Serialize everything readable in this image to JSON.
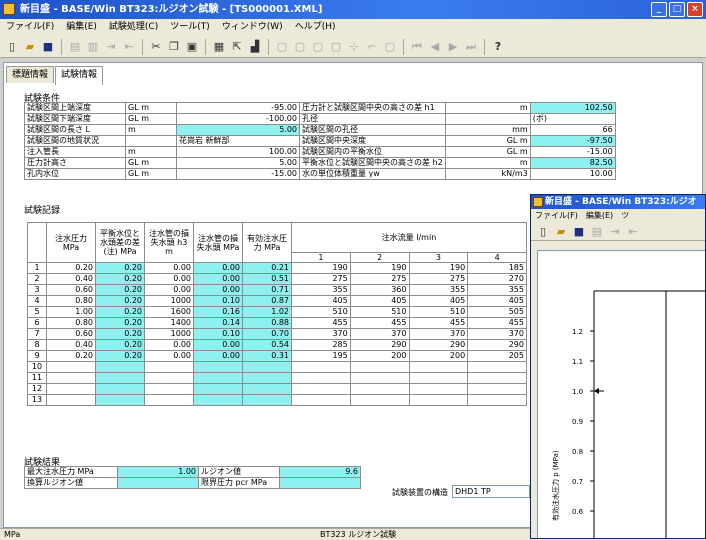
{
  "window": {
    "title": "新目盛 - BASE/Win BT323:ルジオン試験 - [TS000001.XML]",
    "btn_min": "_",
    "btn_max": "□",
    "btn_close": "×"
  },
  "menu": [
    "ファイル(F)",
    "編集(E)",
    "試験処理(C)",
    "ツール(T)",
    "ウィンドウ(W)",
    "ヘルプ(H)"
  ],
  "tabs": [
    "標題情報",
    "試験情報"
  ],
  "conditions": {
    "header": "試験条件",
    "left": [
      {
        "label": "試験区間上端深度",
        "unit": "GL  m",
        "value": "-95.00"
      },
      {
        "label": "試験区間下端深度",
        "unit": "GL  m",
        "value": "-100.00"
      },
      {
        "label": "試験区間の長さ L",
        "unit": "m",
        "value": "5.00"
      },
      {
        "label": "試験区間の地質状況",
        "unit": "",
        "value": "花崗岩 新鮮部"
      },
      {
        "label": "注入管長",
        "unit": "m",
        "value": "100.00"
      },
      {
        "label": "圧力計高さ",
        "unit": "GL  m",
        "value": "5.00"
      },
      {
        "label": "孔内水位",
        "unit": "GL  m",
        "value": "-15.00"
      }
    ],
    "right": [
      {
        "label": "圧力計と試験区間中央の高さの差 h1",
        "unit": "m",
        "value": "102.50"
      },
      {
        "label": "孔径",
        "unit": "",
        "value": "(ボ)"
      },
      {
        "label": "試験区間の孔径",
        "unit": "mm",
        "value": "66"
      },
      {
        "label": "試験区間中央深度",
        "unit": "GL  m",
        "value": "-97.50"
      },
      {
        "label": "試験区間内の平衡水位",
        "unit": "GL  m",
        "value": "-15.00"
      },
      {
        "label": "平衡水位と試験区間中央の高さの差 h2",
        "unit": "m",
        "value": "82.50"
      },
      {
        "label": "水の単位体積重量 γw",
        "unit": "kN/m3",
        "value": "10.00"
      }
    ]
  },
  "record": {
    "header": "試験記録",
    "col_headers": [
      "注水圧力 MPa",
      "平衡水位と水頭差の差(注) MPa",
      "注水管の損失水頭 h3 m",
      "注水管の損失水頭 MPa",
      "有効注水圧力 MPa"
    ],
    "flow_header": "注水流量 l/min",
    "flow_cols": [
      "1",
      "2",
      "3",
      "4"
    ],
    "rows": [
      {
        "n": "1",
        "p": "0.20",
        "a": "0.20",
        "b": "0.00",
        "c": "0.00",
        "d": "0.21",
        "f": [
          "190",
          "190",
          "190",
          "185"
        ]
      },
      {
        "n": "2",
        "p": "0.40",
        "a": "0.20",
        "b": "0.00",
        "c": "0.00",
        "d": "0.51",
        "f": [
          "275",
          "275",
          "275",
          "270"
        ]
      },
      {
        "n": "3",
        "p": "0.60",
        "a": "0.20",
        "b": "0.00",
        "c": "0.00",
        "d": "0.71",
        "f": [
          "355",
          "360",
          "355",
          "355"
        ]
      },
      {
        "n": "4",
        "p": "0.80",
        "a": "0.20",
        "b": "1000",
        "c": "0.10",
        "d": "0.87",
        "f": [
          "405",
          "405",
          "405",
          "405"
        ]
      },
      {
        "n": "5",
        "p": "1.00",
        "a": "0.20",
        "b": "1600",
        "c": "0.16",
        "d": "1.02",
        "f": [
          "510",
          "510",
          "510",
          "505"
        ]
      },
      {
        "n": "6",
        "p": "0.80",
        "a": "0.20",
        "b": "1400",
        "c": "0.14",
        "d": "0.88",
        "f": [
          "455",
          "455",
          "455",
          "455"
        ]
      },
      {
        "n": "7",
        "p": "0.60",
        "a": "0.20",
        "b": "1000",
        "c": "0.10",
        "d": "0.70",
        "f": [
          "370",
          "370",
          "370",
          "370"
        ]
      },
      {
        "n": "8",
        "p": "0.40",
        "a": "0.20",
        "b": "0.00",
        "c": "0.00",
        "d": "0.54",
        "f": [
          "285",
          "290",
          "290",
          "290"
        ]
      },
      {
        "n": "9",
        "p": "0.20",
        "a": "0.20",
        "b": "0.00",
        "c": "0.00",
        "d": "0.31",
        "f": [
          "195",
          "200",
          "200",
          "205"
        ]
      },
      {
        "n": "10",
        "p": "",
        "a": "",
        "b": "",
        "c": "",
        "d": "",
        "f": [
          "",
          "",
          "",
          ""
        ]
      },
      {
        "n": "11",
        "p": "",
        "a": "",
        "b": "",
        "c": "",
        "d": "",
        "f": [
          "",
          "",
          "",
          ""
        ]
      },
      {
        "n": "12",
        "p": "",
        "a": "",
        "b": "",
        "c": "",
        "d": "",
        "f": [
          "",
          "",
          "",
          ""
        ]
      },
      {
        "n": "13",
        "p": "",
        "a": "",
        "b": "",
        "c": "",
        "d": "",
        "f": [
          "",
          "",
          "",
          ""
        ]
      }
    ]
  },
  "results": {
    "header": "試験結果",
    "max_pressure_label": "最大注水圧力   MPa",
    "max_pressure_value": "1.00",
    "lugeon_label": "ルジオン値",
    "lugeon_value": "9.6",
    "conv_lugeon_label": "換算ルジオン値",
    "conv_lugeon_value": "",
    "crit_pressure_label": "限界圧力 pcr  MPa",
    "crit_pressure_value": "",
    "structure_label": "試験装置の構造",
    "structure_value": "DHD1 TP"
  },
  "status": {
    "left": "MPa",
    "center": "BT323 ルジオン試験"
  },
  "subwindow": {
    "title": "新目盛 - BASE/Win BT323:ルジオ",
    "menu": [
      "ファイル(F)",
      "編集(E)",
      "ツ"
    ],
    "y_ticks": [
      "1.2",
      "1.1",
      "1.0",
      "0.9",
      "0.8",
      "0.7",
      "0.6"
    ],
    "y_label": "有効注水圧力 p (MPa)"
  }
}
